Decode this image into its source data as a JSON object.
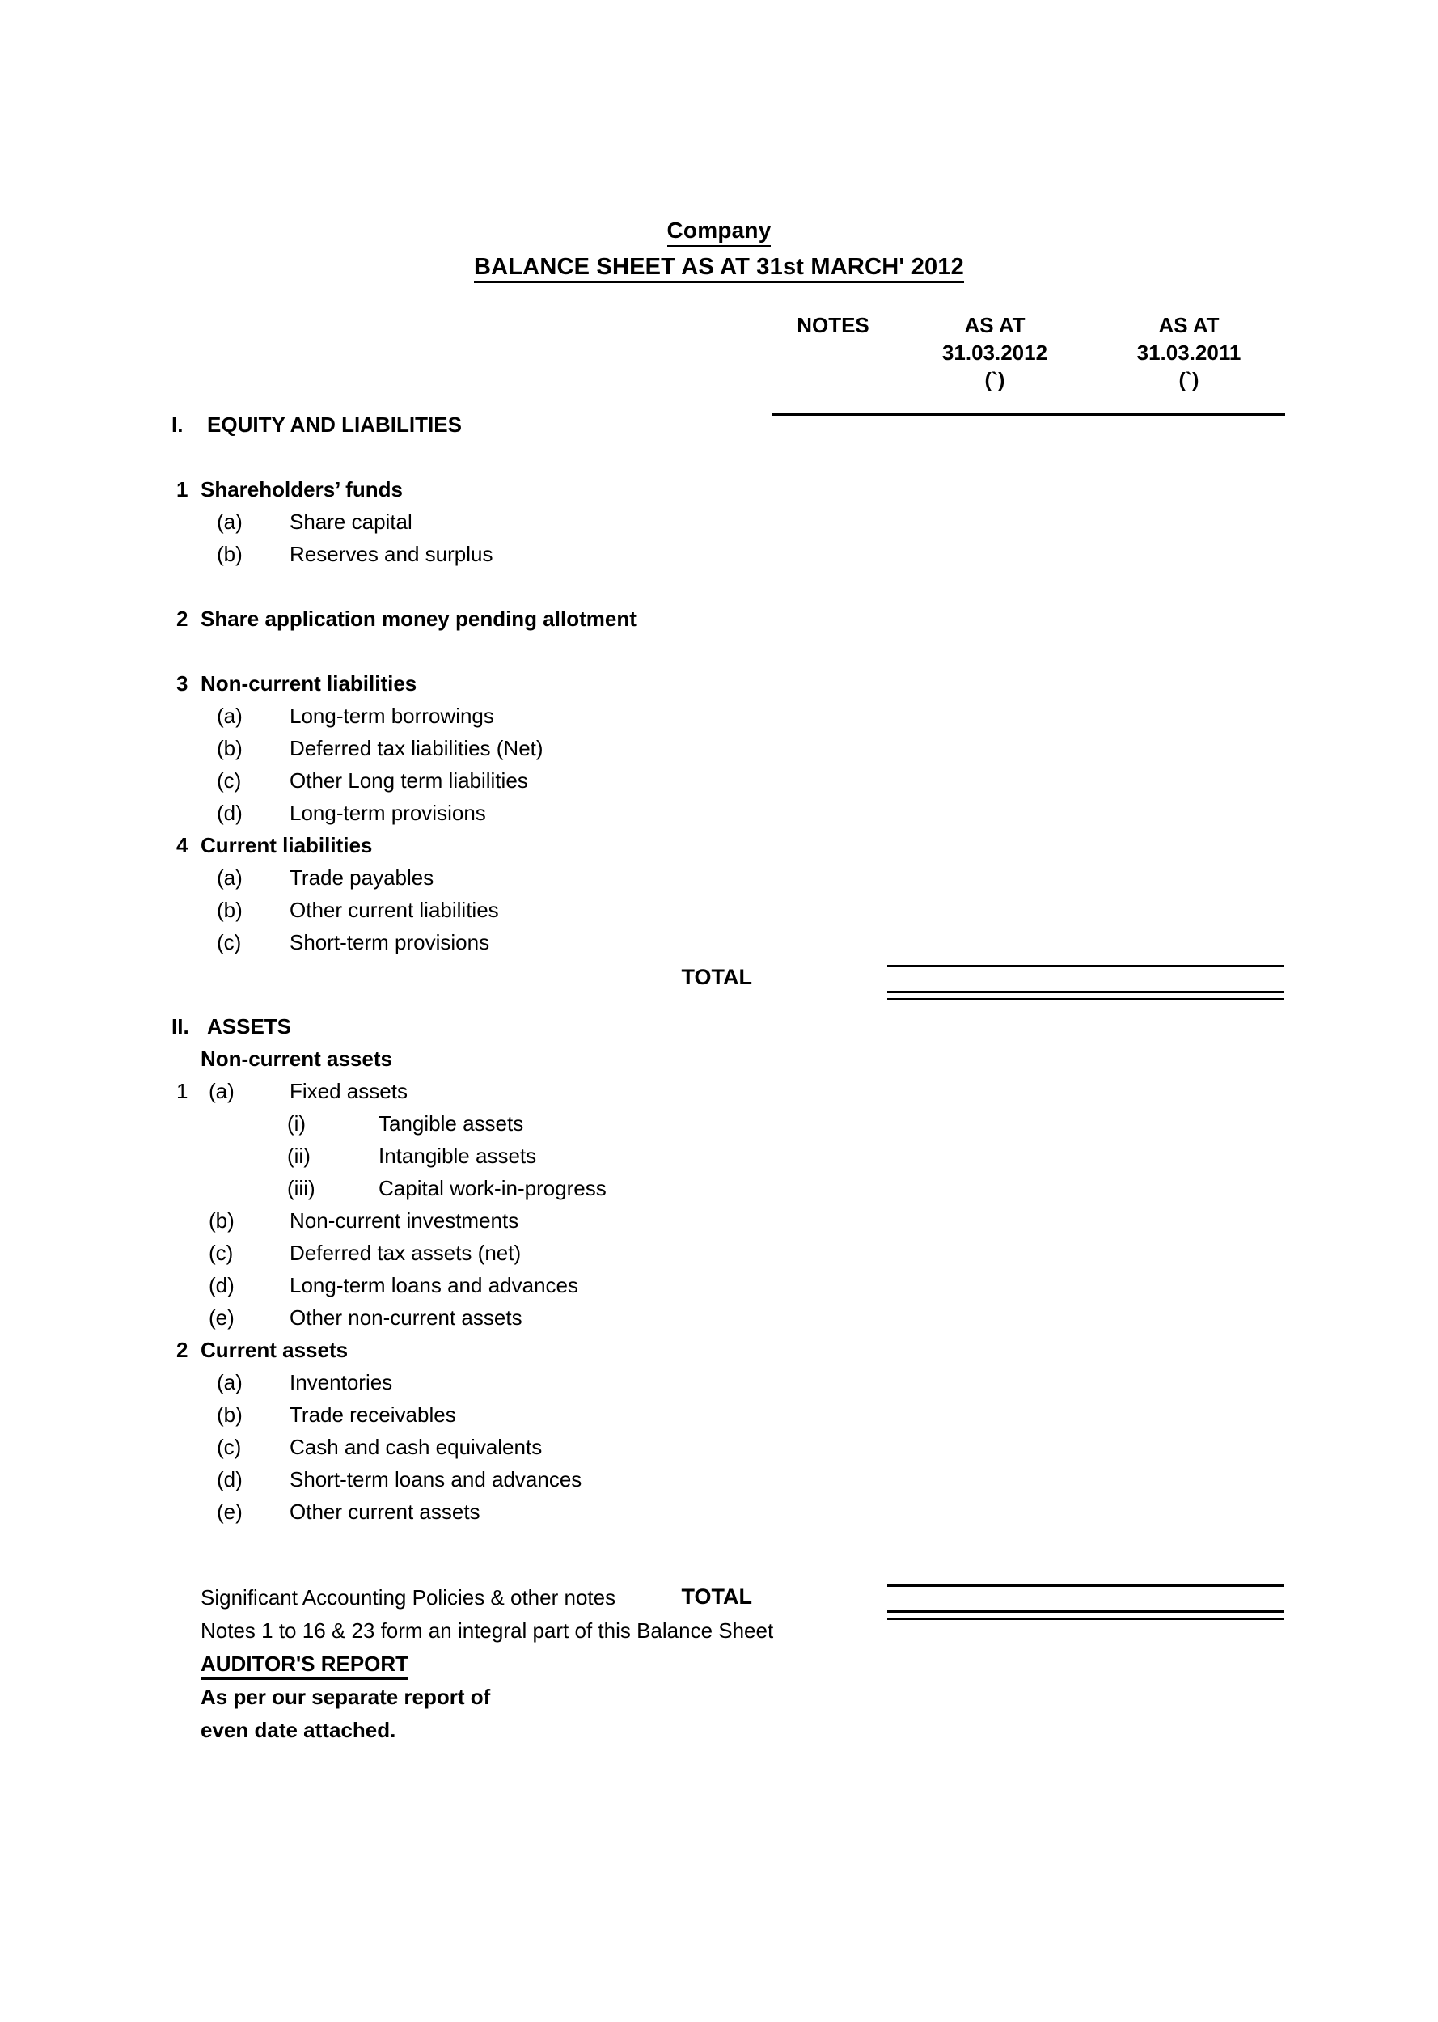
{
  "document": {
    "company_line": "Company",
    "title": "BALANCE SHEET AS AT 31st MARCH' 2012"
  },
  "columns": {
    "notes": "NOTES",
    "as_at_label": "AS AT",
    "current_period": "31.03.2012",
    "prior_period": "31.03.2011",
    "currency_symbol": "(`)"
  },
  "sections": {
    "equity_and_liabilities": {
      "roman": "I.",
      "heading": "EQUITY AND LIABILITIES",
      "groups": {
        "shareholders_funds": {
          "number": "1",
          "heading": "Shareholders’ funds",
          "items": [
            {
              "marker": "(a)",
              "label": "Share capital"
            },
            {
              "marker": "(b)",
              "label": "Reserves and surplus"
            }
          ]
        },
        "share_application": {
          "number": "2",
          "heading": "Share application money pending allotment"
        },
        "non_current_liabilities": {
          "number": "3",
          "heading": "Non-current liabilities",
          "items": [
            {
              "marker": "(a)",
              "label": "Long-term borrowings"
            },
            {
              "marker": "(b)",
              "label": "Deferred tax liabilities (Net)"
            },
            {
              "marker": "(c)",
              "label": "Other Long term liabilities"
            },
            {
              "marker": "(d)",
              "label": "Long-term provisions"
            }
          ]
        },
        "current_liabilities": {
          "number": "4",
          "heading": "Current liabilities",
          "items": [
            {
              "marker": "(a)",
              "label": "Trade payables"
            },
            {
              "marker": "(b)",
              "label": "Other current liabilities"
            },
            {
              "marker": "(c)",
              "label": "Short-term provisions"
            }
          ]
        }
      },
      "total_label": "TOTAL"
    },
    "assets": {
      "roman": "II.",
      "heading": "ASSETS",
      "non_current_heading": "Non-current assets",
      "groups": {
        "non_current_assets": {
          "number": "1",
          "fixed_assets": {
            "marker": "(a)",
            "label": "Fixed assets",
            "sub_items": [
              {
                "marker": "(i)",
                "label": "Tangible assets"
              },
              {
                "marker": "(ii)",
                "label": "Intangible assets"
              },
              {
                "marker": "(iii)",
                "label": "Capital work-in-progress"
              }
            ]
          },
          "items": [
            {
              "marker": "(b)",
              "label": "Non-current investments"
            },
            {
              "marker": "(c)",
              "label": "Deferred tax assets (net)"
            },
            {
              "marker": "(d)",
              "label": "Long-term loans and advances"
            },
            {
              "marker": "(e)",
              "label": "Other non-current assets"
            }
          ]
        },
        "current_assets": {
          "number": "2",
          "heading": "Current assets",
          "items": [
            {
              "marker": "(a)",
              "label": "Inventories"
            },
            {
              "marker": "(b)",
              "label": "Trade receivables"
            },
            {
              "marker": "(c)",
              "label": "Cash and cash equivalents"
            },
            {
              "marker": "(d)",
              "label": "Short-term loans and advances"
            },
            {
              "marker": "(e)",
              "label": "Other current assets"
            }
          ]
        }
      },
      "total_label": "TOTAL"
    }
  },
  "footer": {
    "policies_line": "Significant Accounting Policies & other notes",
    "notes_line": "Notes 1 to 16 & 23 form an integral part of this Balance Sheet",
    "auditor_heading": "AUDITOR'S REPORT",
    "auditor_line_1": "As per our separate report of",
    "auditor_line_2": "even date attached."
  }
}
